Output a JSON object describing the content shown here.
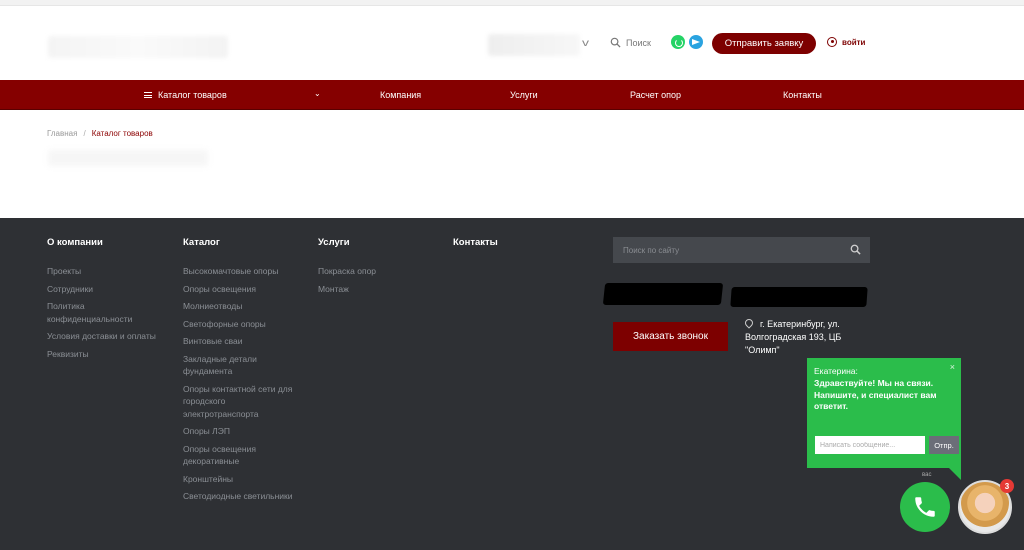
{
  "header": {
    "search_label": "Поиск",
    "request_button": "Отправить заявку",
    "login_label": "войти"
  },
  "nav": {
    "catalog": "Каталог товаров",
    "company": "Компания",
    "services": "Услуги",
    "calc": "Расчет опор",
    "contacts": "Контакты"
  },
  "breadcrumb": {
    "home": "Главная",
    "separator": "/",
    "current": "Каталог товаров"
  },
  "footer": {
    "about": {
      "title": "О компании",
      "links": [
        "Проекты",
        "Сотрудники",
        "Политика конфиденциальности",
        "Условия доставки и оплаты",
        "Реквизиты"
      ]
    },
    "catalog": {
      "title": "Каталог",
      "links": [
        "Высокомачтовые опоры",
        "Опоры освещения",
        "Молниеотводы",
        "Светофорные опоры",
        "Винтовые сваи",
        "Закладные детали фундамента",
        "Опоры контактной сети для городского электротранспорта",
        "Опоры ЛЭП",
        "Опоры освещения декоративные",
        "Кронштейны",
        "Светодиодные светильники"
      ]
    },
    "services": {
      "title": "Услуги",
      "links": [
        "Покраска опор",
        "Монтаж"
      ]
    },
    "contacts": {
      "title": "Контакты"
    },
    "search_placeholder": "Поиск по сайту",
    "callback_button": "Заказать звонок",
    "address": "г. Екатеринбург, ул. Волгоградская 193, ЦБ \"Олимп\""
  },
  "chat": {
    "agent": "Екатерина:",
    "message": "Здравствуйте! Мы на связи. Напишите, и специалист вам ответит.",
    "input_placeholder": "Написать сообщение...",
    "send_label": "Отпр.",
    "close_label": "×",
    "small_label": "вас",
    "badge_count": "3"
  },
  "colors": {
    "brand": "#850000",
    "footer_bg": "#2e3034",
    "chat_green": "#2bbd4b"
  }
}
